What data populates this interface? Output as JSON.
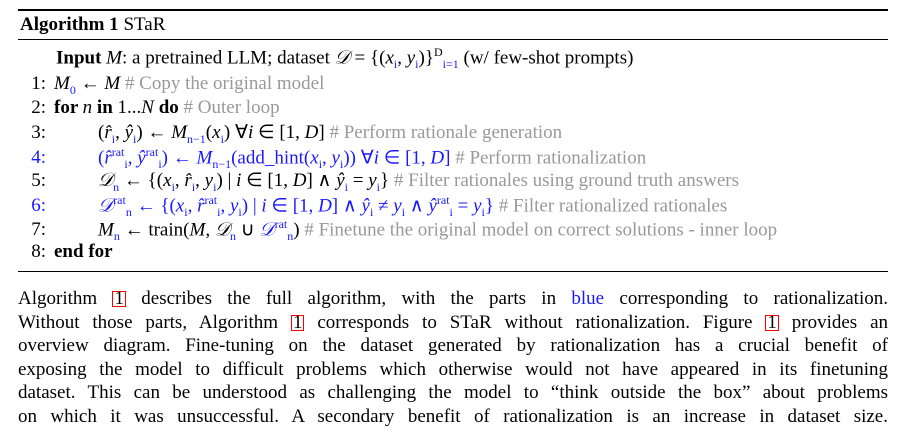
{
  "algorithm": {
    "label": "Algorithm 1",
    "name": "STaR",
    "input": [
      {
        "t": "b",
        "v": "Input "
      },
      {
        "t": "i",
        "v": "M"
      },
      {
        "t": "n",
        "v": ": a pretrained LLM; dataset "
      },
      {
        "t": "i",
        "v": "𝒟"
      },
      {
        "t": "n",
        "v": " = {("
      },
      {
        "t": "i",
        "v": "x"
      },
      {
        "t": "sub",
        "v": "i"
      },
      {
        "t": "n",
        "v": ", "
      },
      {
        "t": "i",
        "v": "y"
      },
      {
        "t": "sub",
        "v": "i"
      },
      {
        "t": "n",
        "v": ")}"
      },
      {
        "t": "sup",
        "v": "D"
      },
      {
        "t": "sub",
        "v": "i=1"
      },
      {
        "t": "n",
        "v": " (w/ few-shot prompts)"
      }
    ],
    "lines": [
      {
        "num": "1:",
        "indent": false,
        "parts": [
          {
            "t": "i",
            "v": "M"
          },
          {
            "t": "sub",
            "v": "0"
          },
          {
            "t": "n",
            "v": " ← "
          },
          {
            "t": "i",
            "v": "M"
          },
          {
            "t": "c",
            "v": " # Copy the original model"
          }
        ]
      },
      {
        "num": "2:",
        "indent": false,
        "parts": [
          {
            "t": "b",
            "v": "for "
          },
          {
            "t": "i",
            "v": "n"
          },
          {
            "t": "b",
            "v": " in "
          },
          {
            "t": "n",
            "v": "1..."
          },
          {
            "t": "i",
            "v": "N"
          },
          {
            "t": "b",
            "v": " do"
          },
          {
            "t": "c",
            "v": " # Outer loop"
          }
        ]
      },
      {
        "num": "3:",
        "indent": true,
        "parts": [
          {
            "t": "n",
            "v": "("
          },
          {
            "t": "i",
            "v": "r̂"
          },
          {
            "t": "sub",
            "v": "i"
          },
          {
            "t": "n",
            "v": ", "
          },
          {
            "t": "i",
            "v": "ŷ"
          },
          {
            "t": "sub",
            "v": "i"
          },
          {
            "t": "n",
            "v": ") ← "
          },
          {
            "t": "i",
            "v": "M"
          },
          {
            "t": "sub",
            "v": "n−1"
          },
          {
            "t": "n",
            "v": "("
          },
          {
            "t": "i",
            "v": "x"
          },
          {
            "t": "sub",
            "v": "i"
          },
          {
            "t": "n",
            "v": ")    ∀"
          },
          {
            "t": "i",
            "v": "i"
          },
          {
            "t": "n",
            "v": " ∈ [1, "
          },
          {
            "t": "i",
            "v": "D"
          },
          {
            "t": "n",
            "v": "]"
          },
          {
            "t": "c",
            "v": " # Perform rationale generation"
          }
        ]
      },
      {
        "num": "4:",
        "indent": true,
        "blue": true,
        "parts": [
          {
            "t": "n",
            "v": "("
          },
          {
            "t": "i",
            "v": "r̂"
          },
          {
            "t": "sup",
            "v": "rat"
          },
          {
            "t": "sub",
            "v": "i"
          },
          {
            "t": "n",
            "v": ", "
          },
          {
            "t": "i",
            "v": "ŷ"
          },
          {
            "t": "sup",
            "v": "rat"
          },
          {
            "t": "sub",
            "v": "i"
          },
          {
            "t": "n",
            "v": ") ← "
          },
          {
            "t": "i",
            "v": "M"
          },
          {
            "t": "sub",
            "v": "n−1"
          },
          {
            "t": "n",
            "v": "(add_hint("
          },
          {
            "t": "i",
            "v": "x"
          },
          {
            "t": "sub",
            "v": "i"
          },
          {
            "t": "n",
            "v": ", "
          },
          {
            "t": "i",
            "v": "y"
          },
          {
            "t": "sub",
            "v": "i"
          },
          {
            "t": "n",
            "v": "))    ∀"
          },
          {
            "t": "i",
            "v": "i"
          },
          {
            "t": "n",
            "v": " ∈ [1, "
          },
          {
            "t": "i",
            "v": "D"
          },
          {
            "t": "n",
            "v": "]"
          },
          {
            "t": "c",
            "v": " # Perform rationalization"
          }
        ]
      },
      {
        "num": "5:",
        "indent": true,
        "parts": [
          {
            "t": "i",
            "v": "𝒟"
          },
          {
            "t": "sub",
            "v": "n"
          },
          {
            "t": "n",
            "v": " ← {("
          },
          {
            "t": "i",
            "v": "x"
          },
          {
            "t": "sub",
            "v": "i"
          },
          {
            "t": "n",
            "v": ", "
          },
          {
            "t": "i",
            "v": "r̂"
          },
          {
            "t": "sub",
            "v": "i"
          },
          {
            "t": "n",
            "v": ", "
          },
          {
            "t": "i",
            "v": "y"
          },
          {
            "t": "sub",
            "v": "i"
          },
          {
            "t": "n",
            "v": ") | "
          },
          {
            "t": "i",
            "v": "i"
          },
          {
            "t": "n",
            "v": " ∈ [1, "
          },
          {
            "t": "i",
            "v": "D"
          },
          {
            "t": "n",
            "v": "] ∧ "
          },
          {
            "t": "i",
            "v": "ŷ"
          },
          {
            "t": "sub",
            "v": "i"
          },
          {
            "t": "n",
            "v": " = "
          },
          {
            "t": "i",
            "v": "y"
          },
          {
            "t": "sub",
            "v": "i"
          },
          {
            "t": "n",
            "v": "}"
          },
          {
            "t": "c",
            "v": " # Filter rationales using ground truth answers"
          }
        ]
      },
      {
        "num": "6:",
        "indent": true,
        "blue": true,
        "parts": [
          {
            "t": "i",
            "v": "𝒟"
          },
          {
            "t": "sup",
            "v": "rat"
          },
          {
            "t": "sub",
            "v": "n"
          },
          {
            "t": "n",
            "v": " ← {("
          },
          {
            "t": "i",
            "v": "x"
          },
          {
            "t": "sub",
            "v": "i"
          },
          {
            "t": "n",
            "v": ", "
          },
          {
            "t": "i",
            "v": "r̂"
          },
          {
            "t": "sup",
            "v": "rat"
          },
          {
            "t": "sub",
            "v": "i"
          },
          {
            "t": "n",
            "v": ", "
          },
          {
            "t": "i",
            "v": "y"
          },
          {
            "t": "sub",
            "v": "i"
          },
          {
            "t": "n",
            "v": ") | "
          },
          {
            "t": "i",
            "v": "i"
          },
          {
            "t": "n",
            "v": " ∈ [1, "
          },
          {
            "t": "i",
            "v": "D"
          },
          {
            "t": "n",
            "v": "] ∧ "
          },
          {
            "t": "i",
            "v": "ŷ"
          },
          {
            "t": "sub",
            "v": "i"
          },
          {
            "t": "n",
            "v": " ≠ "
          },
          {
            "t": "i",
            "v": "y"
          },
          {
            "t": "sub",
            "v": "i"
          },
          {
            "t": "n",
            "v": " ∧ "
          },
          {
            "t": "i",
            "v": "ŷ"
          },
          {
            "t": "sup",
            "v": "rat"
          },
          {
            "t": "sub",
            "v": "i"
          },
          {
            "t": "n",
            "v": " = "
          },
          {
            "t": "i",
            "v": "y"
          },
          {
            "t": "sub",
            "v": "i"
          },
          {
            "t": "n",
            "v": "}"
          },
          {
            "t": "c",
            "v": " # Filter rationalized rationales"
          }
        ]
      },
      {
        "num": "7:",
        "indent": true,
        "parts": [
          {
            "t": "i",
            "v": "M"
          },
          {
            "t": "sub",
            "v": "n"
          },
          {
            "t": "n",
            "v": " ← train("
          },
          {
            "t": "i",
            "v": "M"
          },
          {
            "t": "n",
            "v": ", "
          },
          {
            "t": "i",
            "v": "𝒟"
          },
          {
            "t": "sub",
            "v": "n"
          },
          {
            "t": "n",
            "v": " ∪ "
          },
          {
            "t": "ib",
            "v": "𝒟"
          },
          {
            "t": "supb",
            "v": "rat"
          },
          {
            "t": "subb",
            "v": "n"
          },
          {
            "t": "n",
            "v": ")"
          },
          {
            "t": "c",
            "v": " # Finetune the original model on correct solutions - inner loop"
          }
        ]
      },
      {
        "num": "8:",
        "indent": false,
        "parts": [
          {
            "t": "b",
            "v": "end for"
          }
        ]
      }
    ]
  },
  "paragraph": {
    "lines": [
      [
        {
          "t": "n",
          "v": "Algorithm "
        },
        {
          "t": "ref",
          "v": "1"
        },
        {
          "t": "n",
          "v": " describes the full algorithm, with the parts in "
        },
        {
          "t": "blue",
          "v": "blue"
        },
        {
          "t": "n",
          "v": " corresponding to rationalization."
        }
      ],
      [
        {
          "t": "n",
          "v": "Without those parts, Algorithm "
        },
        {
          "t": "ref",
          "v": "1"
        },
        {
          "t": "n",
          "v": " corresponds to STaR without rationalization. Figure "
        },
        {
          "t": "ref",
          "v": "1"
        },
        {
          "t": "n",
          "v": " provides an"
        }
      ],
      [
        {
          "t": "n",
          "v": "overview diagram. Fine-tuning on the dataset generated by rationalization has a crucial benefit of"
        }
      ],
      [
        {
          "t": "n",
          "v": "exposing the model to difficult problems which otherwise would not have appeared in its finetuning"
        }
      ],
      [
        {
          "t": "n",
          "v": "dataset. This can be understood as challenging the model to “think outside the box” about problems"
        }
      ],
      [
        {
          "t": "n",
          "v": "on which it was unsuccessful. A secondary benefit of rationalization is an increase in dataset size."
        }
      ]
    ]
  },
  "colors": {
    "blue": "#1a1aff",
    "comment": "#999999",
    "link_box": "#ff0000"
  }
}
